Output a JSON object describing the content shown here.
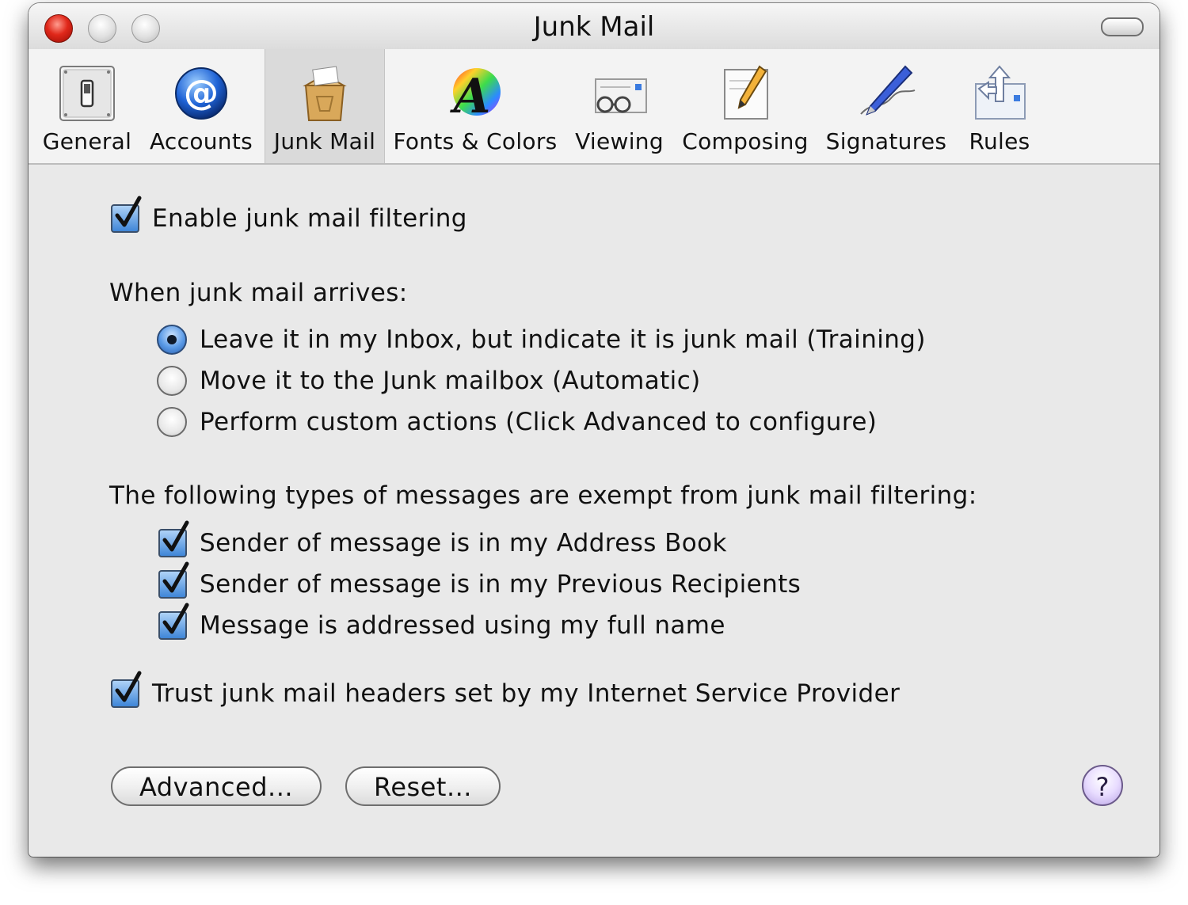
{
  "window": {
    "title": "Junk Mail"
  },
  "toolbar": {
    "items": [
      {
        "label": "General",
        "icon": "light-switch-icon",
        "selected": false
      },
      {
        "label": "Accounts",
        "icon": "at-sign-icon",
        "selected": false
      },
      {
        "label": "Junk Mail",
        "icon": "junk-bag-icon",
        "selected": true
      },
      {
        "label": "Fonts & Colors",
        "icon": "color-font-icon",
        "selected": false
      },
      {
        "label": "Viewing",
        "icon": "glasses-icon",
        "selected": false
      },
      {
        "label": "Composing",
        "icon": "pencil-paper-icon",
        "selected": false
      },
      {
        "label": "Signatures",
        "icon": "fountain-pen-icon",
        "selected": false
      },
      {
        "label": "Rules",
        "icon": "rules-arrows-icon",
        "selected": false
      }
    ]
  },
  "settings": {
    "enable_filtering": {
      "label": "Enable junk mail filtering",
      "checked": true
    },
    "arrival_heading": "When junk mail arrives:",
    "arrival_options": [
      {
        "label": "Leave it in my Inbox, but indicate it is junk mail (Training)",
        "selected": true
      },
      {
        "label": "Move it to the Junk mailbox (Automatic)",
        "selected": false
      },
      {
        "label": "Perform custom actions (Click Advanced to configure)",
        "selected": false
      }
    ],
    "exempt_heading": "The following types of messages are exempt from junk mail filtering:",
    "exempt_options": [
      {
        "label": "Sender of message is in my Address Book",
        "checked": true
      },
      {
        "label": "Sender of message is in my Previous Recipients",
        "checked": true
      },
      {
        "label": "Message is addressed using my full name",
        "checked": true
      }
    ],
    "trust_headers": {
      "label": "Trust junk mail headers set by my Internet Service Provider",
      "checked": true
    }
  },
  "buttons": {
    "advanced": "Advanced...",
    "reset": "Reset...",
    "help": "?"
  },
  "colors": {
    "checkbox_fill": "#3f86d8",
    "close_button": "#e0281a",
    "window_bg": "#e9e9e9"
  }
}
